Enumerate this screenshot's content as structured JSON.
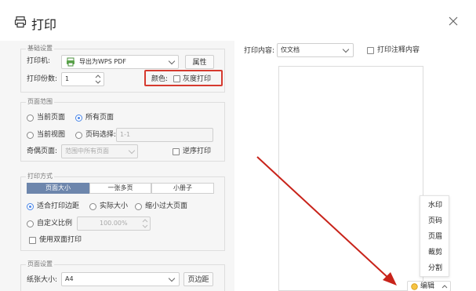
{
  "dialog": {
    "title": "打印"
  },
  "basic": {
    "legend": "基础设置",
    "printer_label": "打印机:",
    "printer_value": "导出为WPS PDF",
    "properties_button": "属性",
    "copies_label": "打印份数:",
    "copies_value": "1",
    "color_label": "颜色:",
    "grayscale_label": "灰度打印"
  },
  "page_range": {
    "legend": "页面范围",
    "current_page": "当前页面",
    "all_pages": "所有页面",
    "current_view": "当前视图",
    "page_select": "页码选择:",
    "page_select_value": "1-1",
    "odd_even_label": "奇偶页面:",
    "odd_even_value": "范围中所有页面",
    "reverse_order": "逆序打印"
  },
  "print_mode": {
    "legend": "打印方式",
    "tabs": [
      "页面大小",
      "一张多页",
      "小册子"
    ],
    "fit_margin": "适合打印边距",
    "actual_size": "实际大小",
    "shrink_large": "缩小过大页面",
    "custom_scale": "自定义比例",
    "custom_scale_value": "100.00%",
    "duplex": "使用双面打印"
  },
  "page_setup": {
    "legend": "页面设置",
    "paper_size_label": "纸张大小:",
    "paper_size_value": "A4",
    "margins_button": "页边距"
  },
  "preview": {
    "content_label": "打印内容:",
    "content_value": "仅文档",
    "print_comments": "打印注释内容"
  },
  "edit_menu": {
    "items": [
      "水印",
      "页码",
      "页眉",
      "裁剪",
      "分割"
    ],
    "button_label": "编辑"
  },
  "colors": {
    "highlight_box": "#d63a2f",
    "arrow": "#c8231a",
    "tab_selected": "#6d86ac",
    "radio_selected": "#4a86e8"
  }
}
